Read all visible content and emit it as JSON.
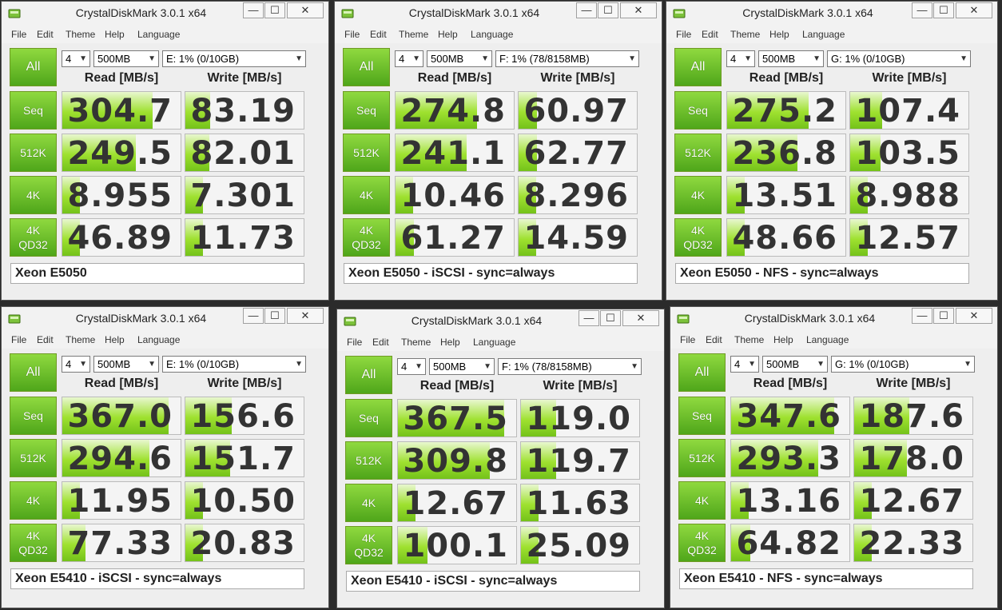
{
  "common": {
    "title": "CrystalDiskMark 3.0.1 x64",
    "menu": [
      "File",
      "Edit",
      "Theme",
      "Help",
      "Language"
    ],
    "controls": {
      "minimize": "—",
      "maximize": "☐",
      "close": "✕"
    },
    "all_label": "All",
    "count": "4",
    "size": "500MB",
    "read_header": "Read [MB/s]",
    "write_header": "Write [MB/s]",
    "rows": [
      {
        "label": "Seq"
      },
      {
        "label": "512K"
      },
      {
        "label": "4K"
      },
      {
        "label": "4K\nQD32"
      }
    ],
    "colors": {
      "button_green": "#6cc62a",
      "bar_green": "#9ee12f"
    }
  },
  "windows": [
    {
      "drive": "E: 1% (0/10GB)",
      "comment": "Xeon E5050",
      "results": [
        {
          "read": "304.7",
          "write": "83.19"
        },
        {
          "read": "249.5",
          "write": "82.01"
        },
        {
          "read": "8.955",
          "write": "7.301"
        },
        {
          "read": "46.89",
          "write": "11.73"
        }
      ]
    },
    {
      "drive": "F: 1% (78/8158MB)",
      "comment": "Xeon E5050 - iSCSI - sync=always",
      "results": [
        {
          "read": "274.8",
          "write": "60.97"
        },
        {
          "read": "241.1",
          "write": "62.77"
        },
        {
          "read": "10.46",
          "write": "8.296"
        },
        {
          "read": "61.27",
          "write": "14.59"
        }
      ]
    },
    {
      "drive": "G: 1% (0/10GB)",
      "comment": "Xeon E5050 - NFS - sync=always",
      "results": [
        {
          "read": "275.2",
          "write": "107.4"
        },
        {
          "read": "236.8",
          "write": "103.5"
        },
        {
          "read": "13.51",
          "write": "8.988"
        },
        {
          "read": "48.66",
          "write": "12.57"
        }
      ]
    },
    {
      "drive": "E: 1% (0/10GB)",
      "comment": "Xeon E5410 - iSCSI - sync=always",
      "results": [
        {
          "read": "367.0",
          "write": "156.6"
        },
        {
          "read": "294.6",
          "write": "151.7"
        },
        {
          "read": "11.95",
          "write": "10.50"
        },
        {
          "read": "77.33",
          "write": "20.83"
        }
      ]
    },
    {
      "drive": "F: 1% (78/8158MB)",
      "comment": "Xeon E5410 - iSCSI - sync=always",
      "results": [
        {
          "read": "367.5",
          "write": "119.0"
        },
        {
          "read": "309.8",
          "write": "119.7"
        },
        {
          "read": "12.67",
          "write": "11.63"
        },
        {
          "read": "100.1",
          "write": "25.09"
        }
      ]
    },
    {
      "drive": "G: 1% (0/10GB)",
      "comment": "Xeon E5410 - NFS - sync=always",
      "results": [
        {
          "read": "347.6",
          "write": "187.6"
        },
        {
          "read": "293.3",
          "write": "178.0"
        },
        {
          "read": "13.16",
          "write": "12.67"
        },
        {
          "read": "64.82",
          "write": "22.33"
        }
      ]
    }
  ]
}
